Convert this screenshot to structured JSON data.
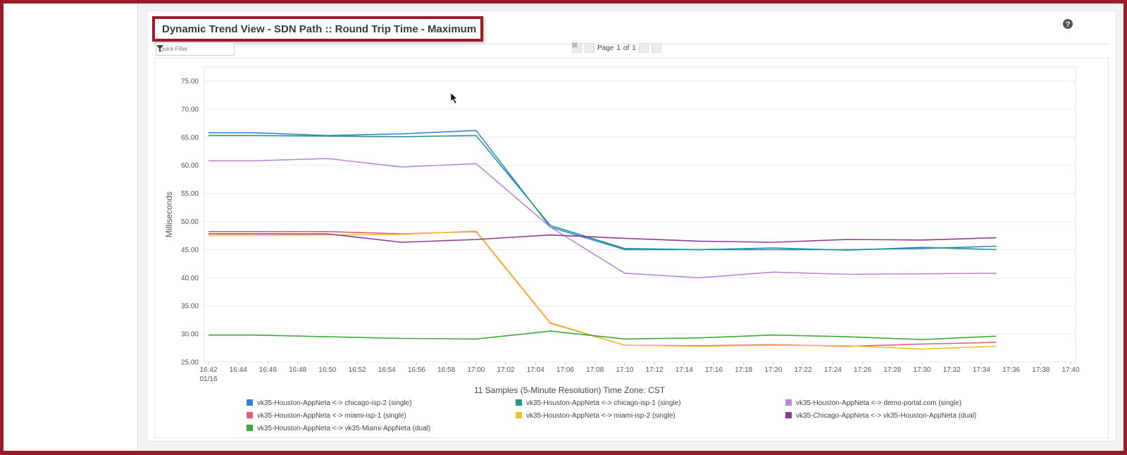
{
  "panel": {
    "title": "Dynamic Trend View - SDN Path :: Round Trip Time - Maximum",
    "filter_placeholder": "Quick Filter",
    "pager": {
      "page_label": "Page",
      "current_page": "1",
      "of_label": "of",
      "total_pages": "1"
    }
  },
  "icons": {
    "collapse": "collapse-icon",
    "settings": "gear-icon",
    "help": "help-icon",
    "filter": "filter-icon"
  },
  "chart_data": {
    "type": "line",
    "title": "",
    "ylabel": "Milliseconds",
    "xlabel": "11 Samples (5-Minute Resolution) Time Zone: CST",
    "ylim": [
      25,
      77.5
    ],
    "y_ticks": [
      "25.00",
      "30.00",
      "35.00",
      "40.00",
      "45.00",
      "50.00",
      "55.00",
      "60.00",
      "65.00",
      "70.00",
      "75.00"
    ],
    "x_ticks": [
      "16:42",
      "16:44",
      "16:46",
      "16:48",
      "16:50",
      "16:52",
      "16:54",
      "16:56",
      "16:58",
      "17:00",
      "17:02",
      "17:04",
      "17:06",
      "17:08",
      "17:10",
      "17:12",
      "17:14",
      "17:16",
      "17:18",
      "17:20",
      "17:22",
      "17:24",
      "17:26",
      "17:28",
      "17:30",
      "17:32",
      "17:34",
      "17:36",
      "17:38",
      "17:40"
    ],
    "x_date_label": "01/16",
    "x_times": [
      "16:42",
      "16:45",
      "16:50",
      "16:55",
      "17:00",
      "17:05",
      "17:10",
      "17:15",
      "17:20",
      "17:25",
      "17:30",
      "17:35"
    ],
    "grid": true,
    "legend_position": "bottom",
    "series": [
      {
        "name": "vk35-Houston-AppNeta <-> chicago-isp-2 (single)",
        "color": "#3b7dd8",
        "values": [
          65.8,
          65.8,
          65.3,
          65.6,
          66.2,
          49.0,
          45.0,
          45.0,
          45.0,
          45.0,
          45.2,
          45.6
        ]
      },
      {
        "name": "vk35-Houston-AppNeta <-> chicago-isp-1 (single)",
        "color": "#1f9a8a",
        "values": [
          65.3,
          65.3,
          65.2,
          65.1,
          65.3,
          49.3,
          45.2,
          45.0,
          45.3,
          44.9,
          45.4,
          45.0
        ]
      },
      {
        "name": "vk35-Houston-AppNeta <-> demo-portal.com (single)",
        "color": "#b88ad6",
        "values": [
          60.8,
          60.8,
          61.2,
          59.7,
          60.3,
          49.0,
          40.8,
          40.0,
          41.0,
          40.6,
          40.7,
          40.8
        ]
      },
      {
        "name": "vk35-Houston-AppNeta <-> miami-isp-1 (single)",
        "color": "#e0607a",
        "values": [
          48.2,
          48.2,
          48.2,
          47.8,
          48.2,
          31.9,
          28.0,
          27.9,
          28.1,
          27.8,
          28.2,
          28.5
        ]
      },
      {
        "name": "vk35-Houston-AppNeta <-> miami-isp-2 (single)",
        "color": "#f2c12e",
        "values": [
          47.5,
          47.5,
          47.6,
          47.7,
          48.3,
          32.0,
          28.0,
          27.8,
          28.0,
          27.9,
          27.3,
          27.8
        ]
      },
      {
        "name": "vk35-Chicago-AppNeta <-> vk35-Houston-AppNeta (dual)",
        "color": "#8e3d8e",
        "values": [
          47.8,
          47.8,
          47.8,
          46.3,
          46.8,
          47.6,
          47.0,
          46.5,
          46.3,
          46.8,
          46.7,
          47.1
        ]
      },
      {
        "name": "vk35-Houston-AppNeta <-> vk35-Miami-AppNeta (dual)",
        "color": "#3faa3a",
        "values": [
          29.8,
          29.8,
          29.5,
          29.2,
          29.1,
          30.5,
          29.1,
          29.3,
          29.8,
          29.5,
          29.0,
          29.6
        ]
      }
    ]
  }
}
